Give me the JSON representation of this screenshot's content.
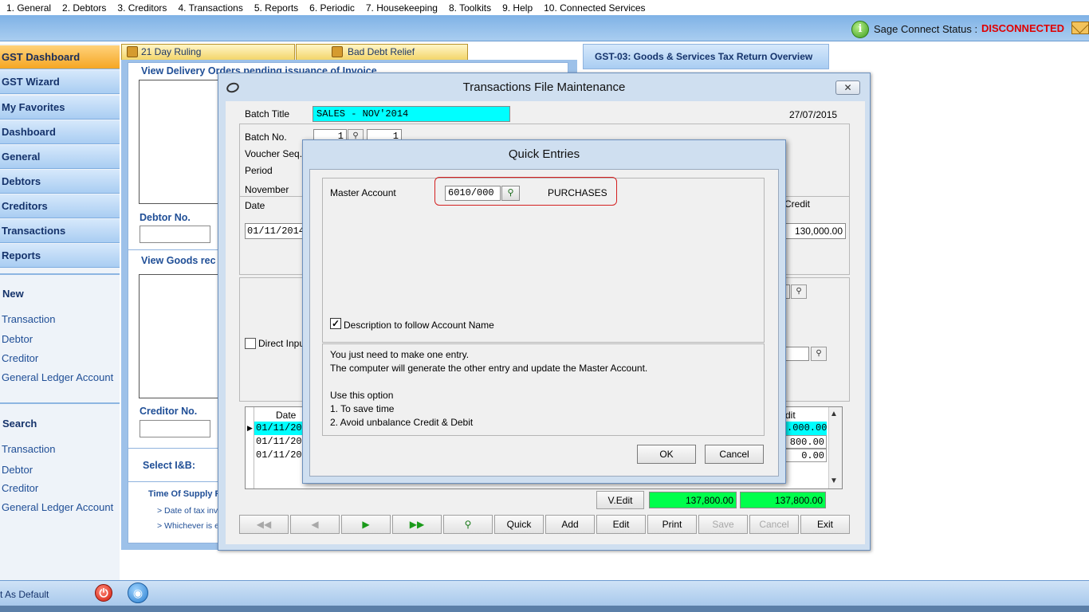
{
  "menu": [
    "1. General",
    "2. Debtors",
    "3. Creditors",
    "4. Transactions",
    "5. Reports",
    "6. Periodic",
    "7. Housekeeping",
    "8. Toolkits",
    "9. Help",
    "10. Connected Services"
  ],
  "status": {
    "label": "Sage Connect Status :",
    "value": "DISCONNECTED",
    "value_color": "#e00000"
  },
  "sidebar": {
    "nav": [
      "GST Dashboard",
      "GST Wizard",
      "My Favorites",
      "Dashboard",
      "General",
      "Debtors",
      "Creditors",
      "Transactions",
      "Reports"
    ],
    "new_title": "New",
    "new_links": [
      "Transaction",
      "Debtor",
      "Creditor",
      "General Ledger Account"
    ],
    "search_title": "Search",
    "search_links": [
      "Transaction",
      "Debtor",
      "Creditor",
      "General Ledger Account"
    ],
    "set_default": "t As Default"
  },
  "tabs": {
    "day_ruling": "21 Day Ruling",
    "bad_debt": "Bad Debt Relief",
    "gst03": "GST-03: Goods & Services Tax Return Overview"
  },
  "bg_panel": {
    "view_delivery": "View Delivery Orders pending issuance of Invoice",
    "debtor_no": "Debtor No.",
    "view_goods": "View Goods rec",
    "creditor_no": "Creditor No.",
    "select_ib": "Select I&B:",
    "time_of_supply": "Time Of Supply R",
    "bullet1": "> Date of tax invo",
    "bullet2": "> Whichever is e"
  },
  "tfm": {
    "title": "Transactions File Maintenance",
    "batch_title_label": "Batch Title",
    "batch_title_value": "SALES - NOV'2014",
    "date": "27/07/2015",
    "batch_no_label": "Batch No.",
    "batch_no_value": "1",
    "batch_no_value2": "1",
    "voucher_seq_label": "Voucher Seq.",
    "period_label": "Period",
    "period_value": "November",
    "date_label": "Date",
    "date_value": "01/11/2014",
    "credit_label": "Credit",
    "credit_value": "130,000.00",
    "direct_input_label": "Direct Inpu",
    "grid_date_header": "Date",
    "grid_credit_header": "dit",
    "grid_rows": [
      {
        "date": "01/11/20",
        "credit": ".000.00"
      },
      {
        "date": "01/11/20",
        "credit": "800.00"
      },
      {
        "date": "01/11/20",
        "credit": "0.00"
      }
    ],
    "vedit_label": "V.Edit",
    "total_debit": "137,800.00",
    "total_credit": "137,800.00",
    "buttons": {
      "quick": "Quick",
      "add": "Add",
      "edit": "Edit",
      "print": "Print",
      "save": "Save",
      "cancel": "Cancel",
      "exit": "Exit"
    }
  },
  "quick_entries": {
    "title": "Quick Entries",
    "master_label": "Master Account",
    "master_value": "6010/000",
    "master_name": "PURCHASES",
    "desc_label": "Description to follow Account Name",
    "info": [
      "You just need to make one entry.",
      "The computer will generate the other entry and update the Master Account.",
      "Use this option",
      "1. To save time",
      "2. Avoid unbalance Credit & Debit"
    ],
    "ok": "OK",
    "cancel": "Cancel"
  }
}
